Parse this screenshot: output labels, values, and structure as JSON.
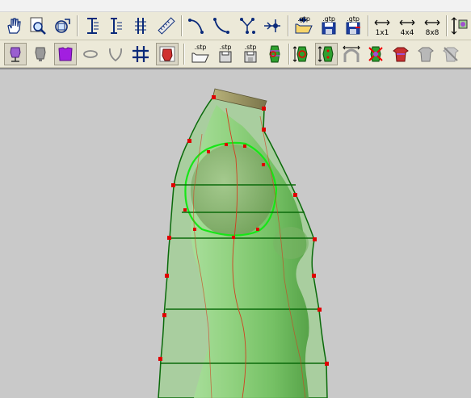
{
  "toolbar1": {
    "save_group_a": {
      "label": ".gtp"
    },
    "save_group_b": {
      "label": ".gtp"
    },
    "save_group_c": {
      "label": ".gtp"
    },
    "grid_1x1": "1x1",
    "grid_4x4": "4x4",
    "grid_8x8": "8x8"
  },
  "toolbar2": {
    "stp_a": ".stp",
    "stp_b": ".stp",
    "stp_c": ".stp"
  },
  "colors": {
    "toolbar_bg": "#ece9d8",
    "viewport_bg": "#c9c9c9",
    "mesh_green": "#0a7a0a",
    "control_point": "#e00000",
    "body_fill": "#7ec86a"
  },
  "icons": [
    "hand-pan-icon",
    "zoom-region-icon",
    "rotate-view-icon",
    "vertical-spacing-icon",
    "vertical-lines-icon",
    "vertical-grid-icon",
    "ruler-icon",
    "curve-left-icon",
    "curve-right-icon",
    "grid-points-icon",
    "snap-point-icon",
    "open-gtp-icon",
    "save-gtp-icon",
    "save-gtp-alt-icon",
    "grid-1x1-icon",
    "grid-4x4-icon",
    "grid-8x8-icon",
    "fit-vertical-icon",
    "mannequin-small-icon",
    "mannequin-stand-icon",
    "mannequin-grey-icon",
    "torso-purple-icon",
    "ellipse-icon",
    "neck-curve-icon",
    "grid-hash-icon",
    "texture-body-icon",
    "open-stp-icon",
    "save-stp-icon",
    "save-stp-alt-icon",
    "body-sections-icon",
    "height-measure-icon",
    "height-range-icon",
    "arc-measure-icon",
    "body-cross-icon",
    "torso-red-icon",
    "torso-grey-icon",
    "torso-disabled-icon"
  ]
}
